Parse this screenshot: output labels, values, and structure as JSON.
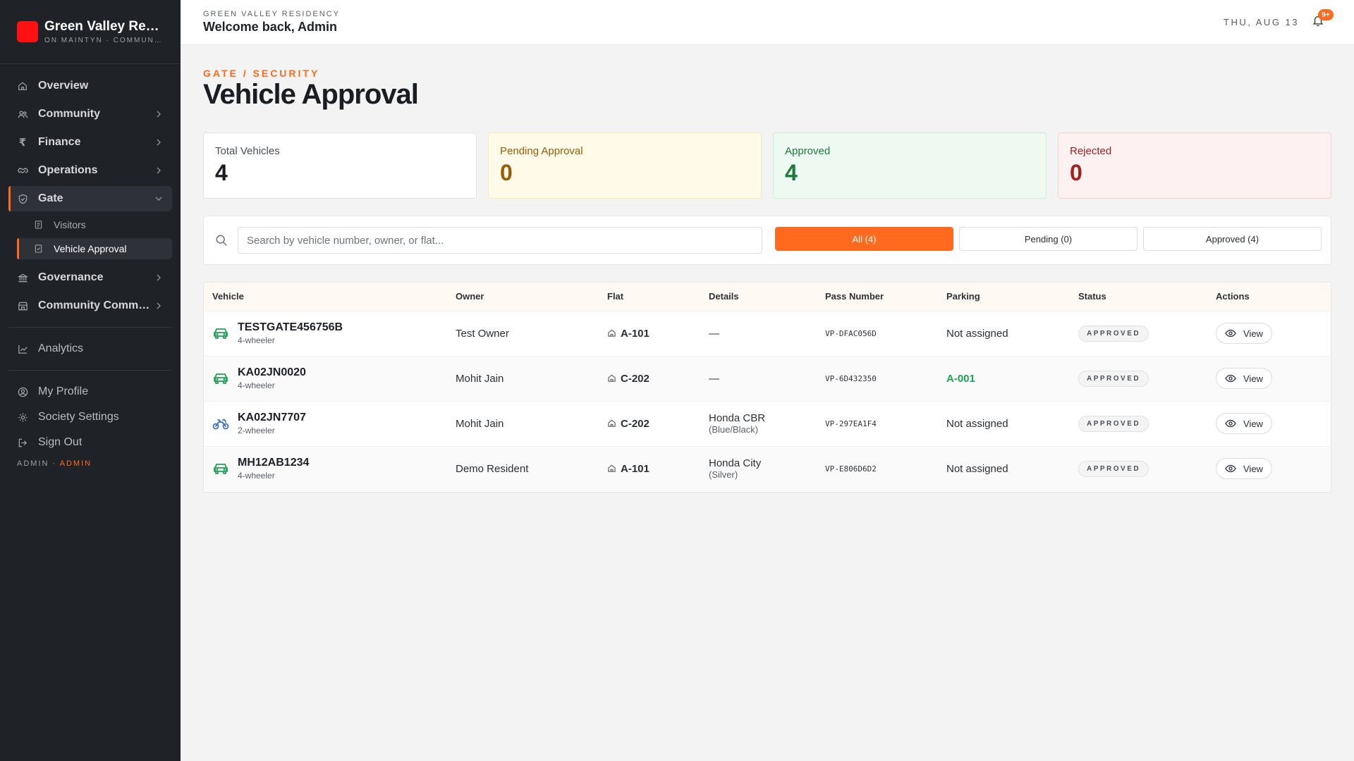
{
  "brand": {
    "name": "Green Valley Residency",
    "subtitle": "ON MAINTYN · COMMUNITY",
    "logo_color": "#ff1111"
  },
  "sidebar": {
    "items": [
      {
        "label": "Overview",
        "icon": "home-icon"
      },
      {
        "label": "Community",
        "icon": "users-icon",
        "expandable": true
      },
      {
        "label": "Finance",
        "icon": "rupee-icon",
        "expandable": true
      },
      {
        "label": "Operations",
        "icon": "handshake-icon",
        "expandable": true
      },
      {
        "label": "Gate",
        "icon": "shield-icon",
        "expanded": true,
        "active": true
      },
      {
        "label": "Governance",
        "icon": "landmark-icon",
        "expandable": true
      },
      {
        "label": "Community Commerce",
        "icon": "store-icon",
        "expandable": true
      },
      {
        "label": "Analytics",
        "icon": "chart-icon"
      }
    ],
    "gate_sub_items": [
      {
        "label": "Visitors",
        "icon": "clipboard-icon"
      },
      {
        "label": "Vehicle Approval",
        "icon": "clipboard-check-icon",
        "active": true
      }
    ],
    "footer_items": [
      {
        "label": "My Profile",
        "icon": "user-circle-icon"
      },
      {
        "label": "Society Settings",
        "icon": "gear-icon"
      },
      {
        "label": "Sign Out",
        "icon": "logout-icon"
      }
    ],
    "role": {
      "prefix": "ADMIN",
      "separator": "·",
      "value": "ADMIN"
    }
  },
  "topbar": {
    "society": "GREEN VALLEY RESIDENCY",
    "welcome": "Welcome back, Admin",
    "date": "THU, AUG 13",
    "notification_badge": "9+"
  },
  "page": {
    "breadcrumb": "GATE / SECURITY",
    "title": "Vehicle Approval"
  },
  "stats": [
    {
      "label": "Total Vehicles",
      "value": "4"
    },
    {
      "label": "Pending Approval",
      "value": "0"
    },
    {
      "label": "Approved",
      "value": "4"
    },
    {
      "label": "Rejected",
      "value": "0"
    }
  ],
  "search": {
    "placeholder": "Search by vehicle number, owner, or flat...",
    "value": ""
  },
  "tabs": [
    {
      "label": "All (4)",
      "active": true
    },
    {
      "label": "Pending (0)"
    },
    {
      "label": "Approved (4)"
    }
  ],
  "table": {
    "headers": [
      "Vehicle",
      "Owner",
      "Flat",
      "Details",
      "Pass Number",
      "Parking",
      "Status",
      "Actions"
    ],
    "rows": [
      {
        "vehicle": "TESTGATE456756B",
        "type": "4-wheeler",
        "icon": "car-icon",
        "owner": "Test Owner",
        "flat": "A-101",
        "details": "—",
        "details_sub": "",
        "pass": "VP-DFAC056D",
        "parking": "Not assigned",
        "status": "APPROVED",
        "action": "View"
      },
      {
        "vehicle": "KA02JN0020",
        "type": "4-wheeler",
        "icon": "car-icon",
        "owner": "Mohit Jain",
        "flat": "C-202",
        "details": "—",
        "details_sub": "",
        "pass": "VP-6D432350",
        "parking": "A-001",
        "status": "APPROVED",
        "action": "View"
      },
      {
        "vehicle": "KA02JN7707",
        "type": "2-wheeler",
        "icon": "motorbike-icon",
        "owner": "Mohit Jain",
        "flat": "C-202",
        "details": "Honda CBR",
        "details_sub": "(Blue/Black)",
        "pass": "VP-297EA1F4",
        "parking": "Not assigned",
        "status": "APPROVED",
        "action": "View"
      },
      {
        "vehicle": "MH12AB1234",
        "type": "4-wheeler",
        "icon": "car-icon",
        "owner": "Demo Resident",
        "flat": "A-101",
        "details": "Honda City",
        "details_sub": "(Silver)",
        "pass": "VP-E806D6D2",
        "parking": "Not assigned",
        "status": "APPROVED",
        "action": "View"
      }
    ]
  },
  "colors": {
    "accent": "#ff6a1f",
    "sidebar_bg": "#1f2226",
    "approved_green": "#21a153"
  }
}
